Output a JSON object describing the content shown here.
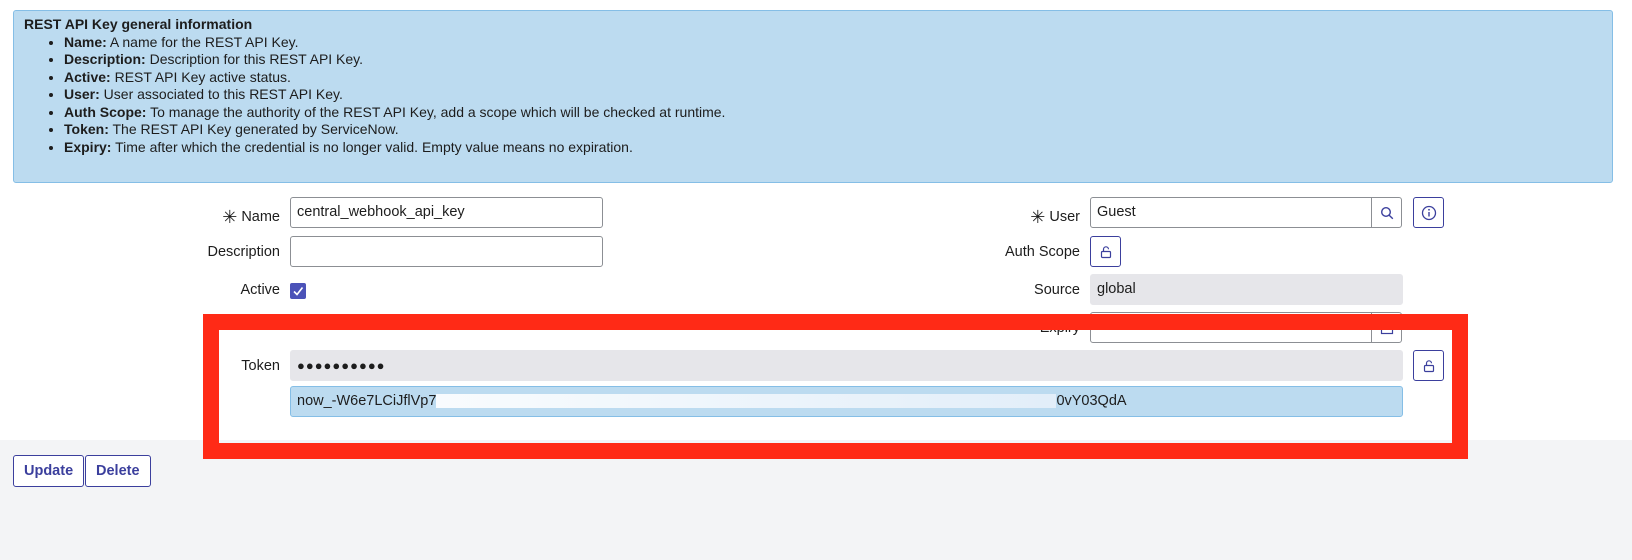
{
  "info": {
    "title": "REST API Key general information",
    "items": [
      {
        "term": "Name:",
        "desc": " A name for the REST API Key."
      },
      {
        "term": "Description:",
        "desc": " Description for this REST API Key."
      },
      {
        "term": "Active:",
        "desc": " REST API Key active status."
      },
      {
        "term": "User:",
        "desc": " User associated to this REST API Key."
      },
      {
        "term": "Auth Scope:",
        "desc": " To manage the authority of the REST API Key, add a scope which will be checked at runtime."
      },
      {
        "term": "Token:",
        "desc": " The REST API Key generated by ServiceNow."
      },
      {
        "term": "Expiry:",
        "desc": " Time after which the credential is no longer valid. Empty value means no expiration."
      }
    ]
  },
  "form": {
    "required_mark": "✳",
    "name_label": "Name",
    "name_value": "central_webhook_api_key",
    "description_label": "Description",
    "description_value": "",
    "active_label": "Active",
    "active_checked": true,
    "user_label": "User",
    "user_value": "Guest",
    "auth_scope_label": "Auth Scope",
    "source_label": "Source",
    "source_value": "global",
    "expiry_label": "Expiry",
    "expiry_value": "",
    "token_label": "Token",
    "token_masked": "●●●●●●●●●●",
    "token_value_start": "now_-W6e7LCiJflVp7",
    "token_value_end": "0vY03QdA"
  },
  "actions": {
    "update_label": "Update",
    "delete_label": "Delete"
  },
  "colors": {
    "accent": "#3b3f9d",
    "info_bg": "#bcdbf0",
    "highlight_red": "#ff2a16"
  }
}
